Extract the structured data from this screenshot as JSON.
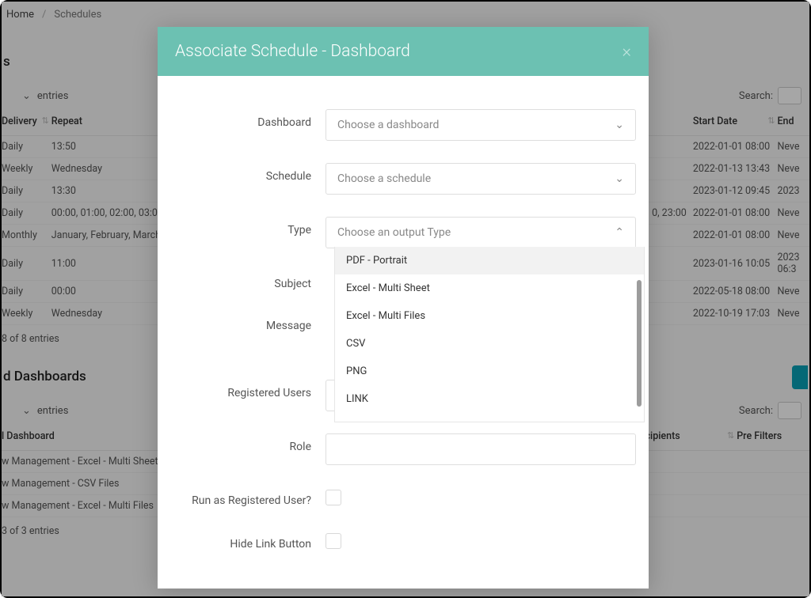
{
  "breadcrumbs": {
    "home": "Home",
    "current": "Schedules"
  },
  "top": {
    "entries_label": "entries",
    "search_label": "Search:",
    "cols": {
      "delivery": "Delivery",
      "repeat": "Repeat",
      "start": "Start Date",
      "end": "End"
    },
    "rows": [
      {
        "delivery": "Daily",
        "repeat": "13:50",
        "start": "2022-01-01 08:00",
        "end": "Neve"
      },
      {
        "delivery": "Weekly",
        "repeat": "Wednesday",
        "start": "2022-01-13 13:43",
        "end": "Neve"
      },
      {
        "delivery": "Daily",
        "repeat": "13:30",
        "start": "2023-01-12 09:45",
        "end": "2023"
      },
      {
        "delivery": "Daily",
        "repeat": "00:00, 01:00, 02:00, 03:0",
        "start": "2022-01-01 08:00",
        "end": "Neve",
        "extra_right": "0, 23:00"
      },
      {
        "delivery": "Monthly",
        "repeat": "January, February, March",
        "start": "2022-01-01 08:00",
        "end": "Neve"
      },
      {
        "delivery": "Daily",
        "repeat": "11:00",
        "start": "2023-01-16 10:05",
        "end": "2023\n06:3"
      },
      {
        "delivery": "Daily",
        "repeat": "00:00",
        "start": "2022-05-18 08:00",
        "end": "Neve"
      },
      {
        "delivery": "Weekly",
        "repeat": "Wednesday",
        "start": "2022-10-19 17:03",
        "end": "Neve"
      }
    ],
    "footer": "8 of 8 entries"
  },
  "section2": {
    "title": "d Dashboards",
    "entries_label": "entries",
    "search_label": "Search:",
    "cols": {
      "dashboard": "l Dashboard",
      "recipients": "ecipients",
      "prefilters": "Pre Filters"
    },
    "rows": [
      "w Management - Excel - Multi Sheet",
      "w Management - CSV Files",
      "w Management - Excel - Multi Files"
    ],
    "footer": "3 of 3 entries"
  },
  "modal": {
    "title": "Associate Schedule - Dashboard",
    "labels": {
      "dashboard": "Dashboard",
      "schedule": "Schedule",
      "type": "Type",
      "subject": "Subject",
      "message": "Message",
      "reg_users": "Registered Users",
      "role": "Role",
      "run_as": "Run as Registered User?",
      "hide_link": "Hide Link Button"
    },
    "placeholders": {
      "dashboard": "Choose a dashboard",
      "schedule": "Choose a schedule",
      "type": "Choose an output Type"
    },
    "type_options": [
      "PDF - Portrait",
      "Excel - Multi Sheet",
      "Excel - Multi Files",
      "CSV",
      "PNG",
      "LINK"
    ]
  }
}
